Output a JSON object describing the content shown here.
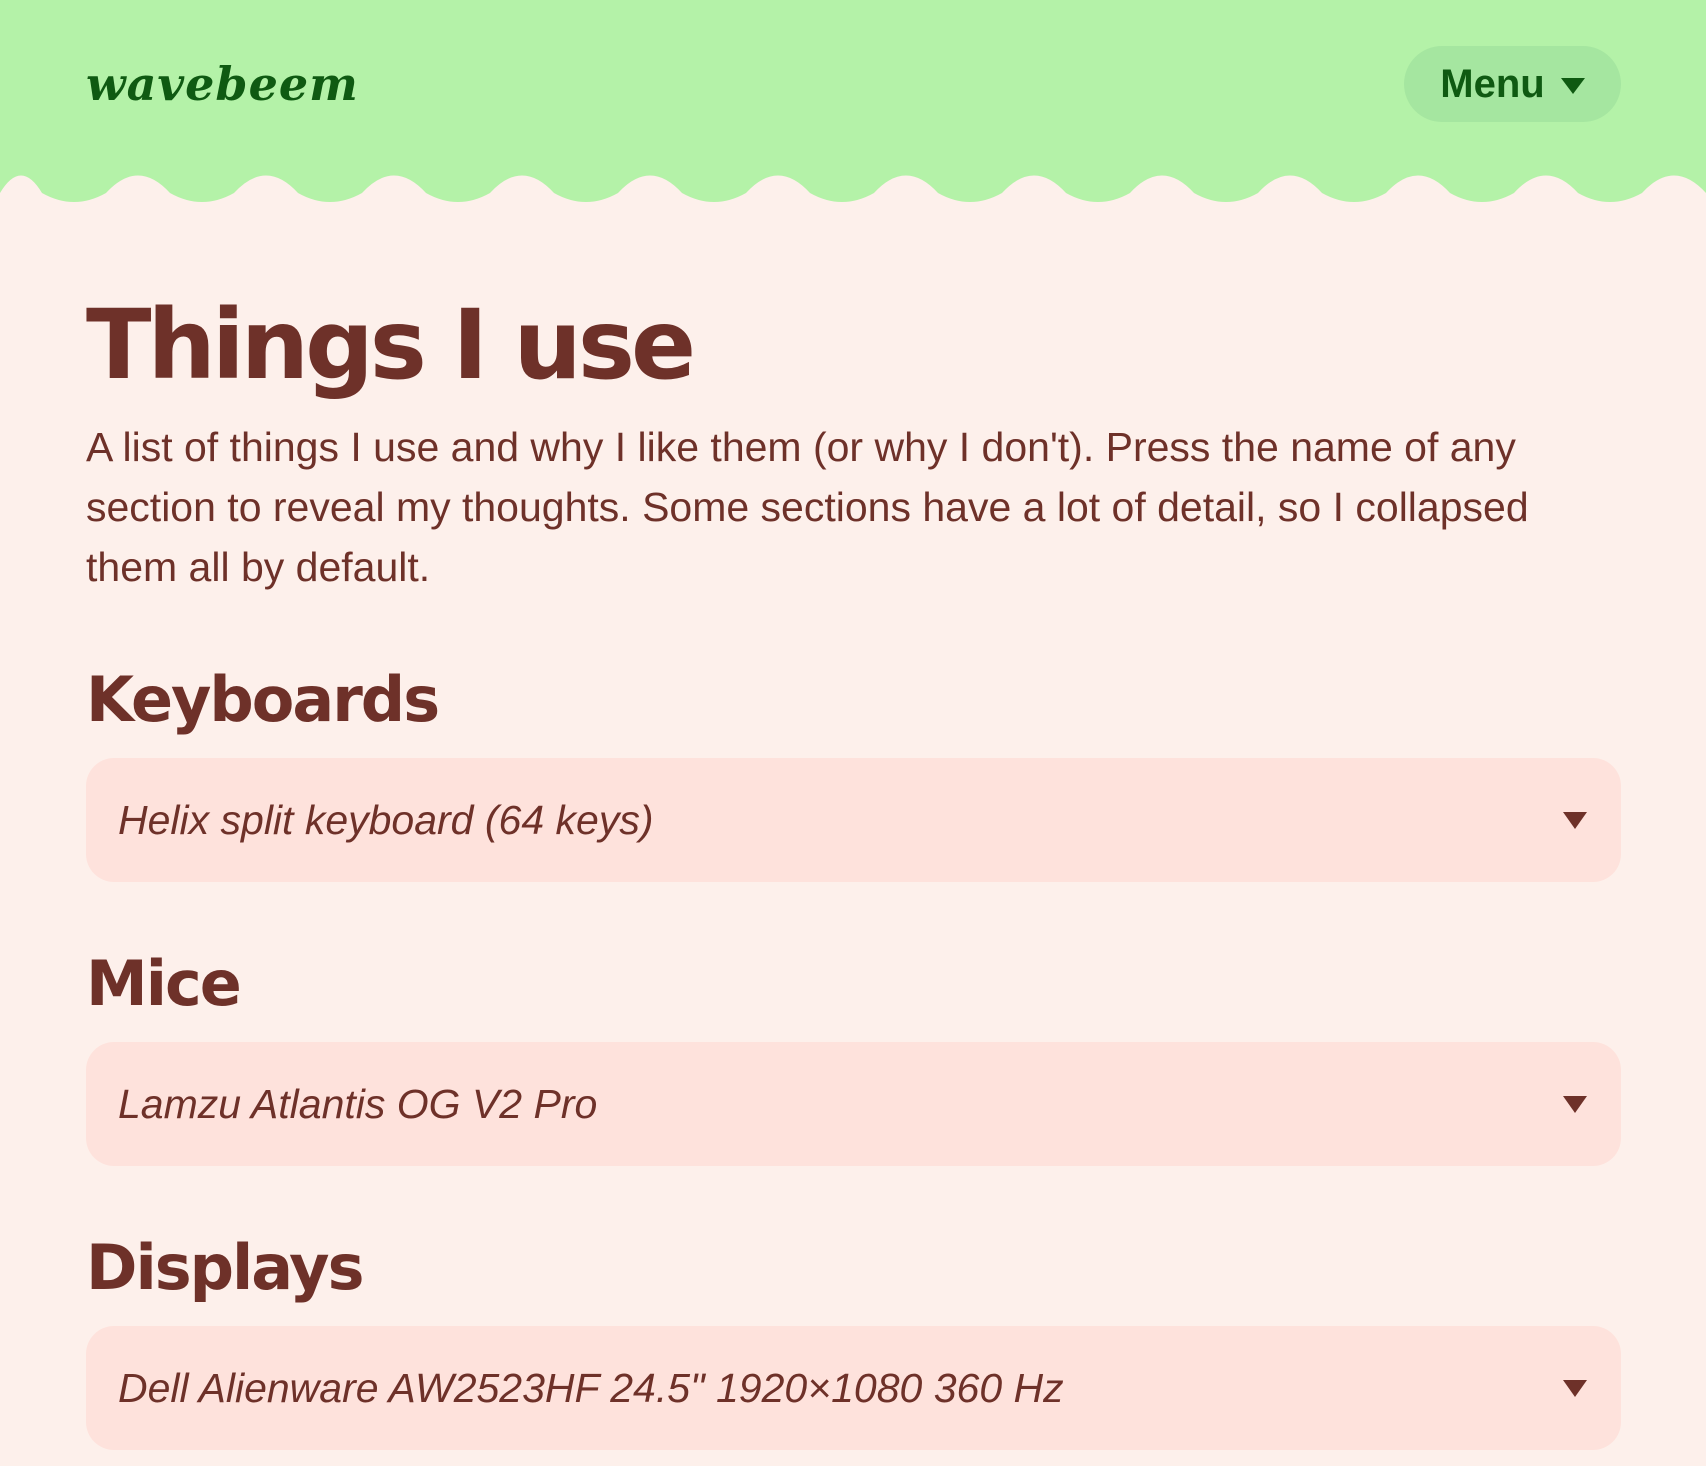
{
  "header": {
    "logo_text": "wavebeem",
    "menu_label": "Menu",
    "background_color": "#b4f2a8",
    "accent_color": "#0f5a12"
  },
  "main": {
    "title": "Things I use",
    "intro": "A list of things I use and why I like them (or why I don't). Press the name of any section to reveal my thoughts. Some sections have a lot of detail, so I collapsed them all by default."
  },
  "sections": [
    {
      "heading": "Keyboards",
      "item": "Helix split keyboard (64 keys)"
    },
    {
      "heading": "Mice",
      "item": "Lamzu Atlantis OG V2 Pro"
    },
    {
      "heading": "Displays",
      "item": "Dell Alienware AW2523HF 24.5\" 1920×1080 360 Hz"
    }
  ],
  "icons": {
    "menu_caret": "caret-down-icon",
    "accordion_caret": "caret-down-icon"
  },
  "colors": {
    "page_background": "#fdf0eb",
    "text": "#6e3129",
    "accordion_background": "#fee2dc",
    "menu_button_background": "#a5e6a0"
  }
}
